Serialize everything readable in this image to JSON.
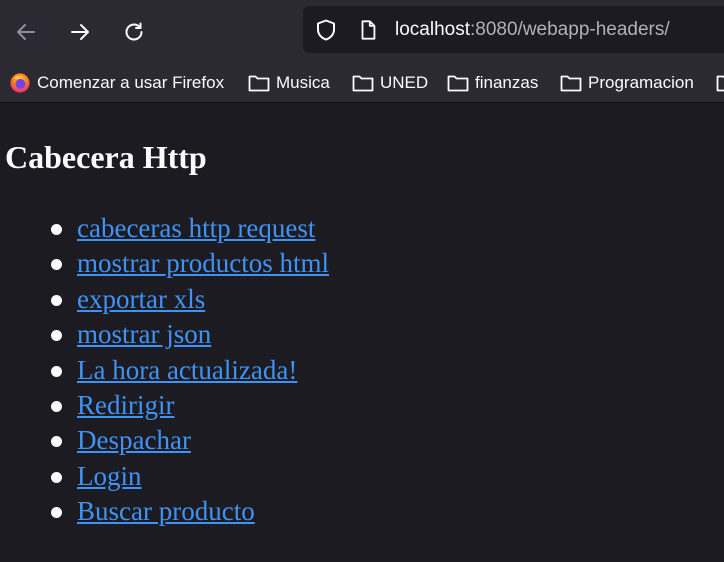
{
  "browser": {
    "url_host": "localhost",
    "url_rest": ":8080/webapp-headers/",
    "bookmarks": [
      {
        "label": "Comenzar a usar Firefox",
        "icon": "firefox-icon"
      },
      {
        "label": "Musica",
        "icon": "folder-icon"
      },
      {
        "label": "UNED",
        "icon": "folder-icon"
      },
      {
        "label": "finanzas",
        "icon": "folder-icon"
      },
      {
        "label": "Programacion",
        "icon": "folder-icon"
      }
    ]
  },
  "page": {
    "title": "Cabecera Http",
    "links": [
      "cabeceras http request",
      "mostrar productos html",
      "exportar xls",
      "mostrar json",
      "La hora actualizada!",
      "Redirigir",
      "Despachar",
      "Login",
      "Buscar producto"
    ]
  },
  "colors": {
    "link": "#3f93f5",
    "toolbar": "#2b2a33",
    "background": "#1c1b22"
  }
}
